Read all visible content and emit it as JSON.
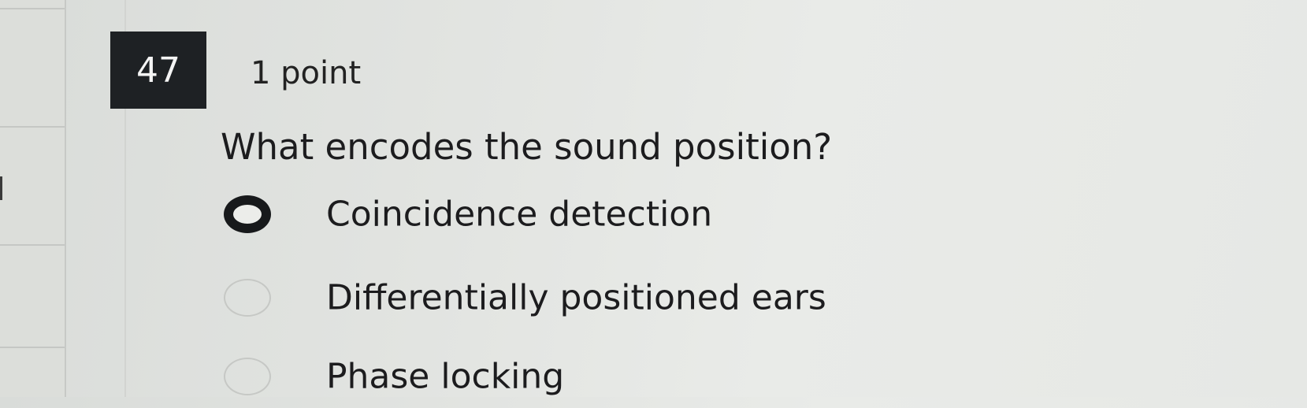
{
  "question": {
    "number": "47",
    "points": "1 point",
    "text": "What encodes the sound position?"
  },
  "options": [
    {
      "label": "Coincidence detection",
      "selected": true
    },
    {
      "label": "Differentially positioned ears",
      "selected": false
    },
    {
      "label": "Phase locking",
      "selected": false
    }
  ]
}
